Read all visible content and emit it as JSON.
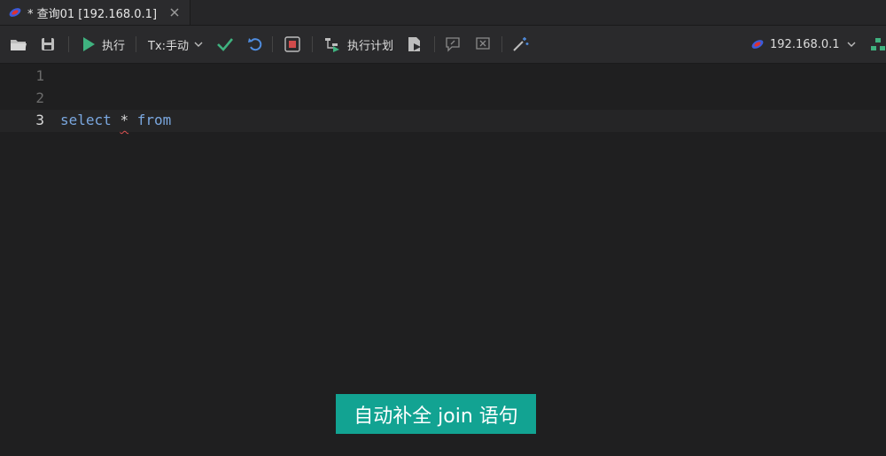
{
  "tab": {
    "title": "* 查询01 [192.168.0.1]"
  },
  "toolbar": {
    "execute_label": "执行",
    "tx_label": "Tx:手动",
    "plan_label": "执行计划",
    "connection_label": "192.168.0.1"
  },
  "editor": {
    "line_numbers": [
      "1",
      "2",
      "3"
    ],
    "line3": {
      "kw1": "select",
      "op": "*",
      "kw2": "from"
    }
  },
  "caption": {
    "text": "自动补全 join 语句"
  },
  "colors": {
    "background": "#1f1f20",
    "keyword": "#7aa7df",
    "accent_green": "#3fb27f",
    "caption_bg": "#12a392",
    "stop_red": "#d14b4b"
  }
}
